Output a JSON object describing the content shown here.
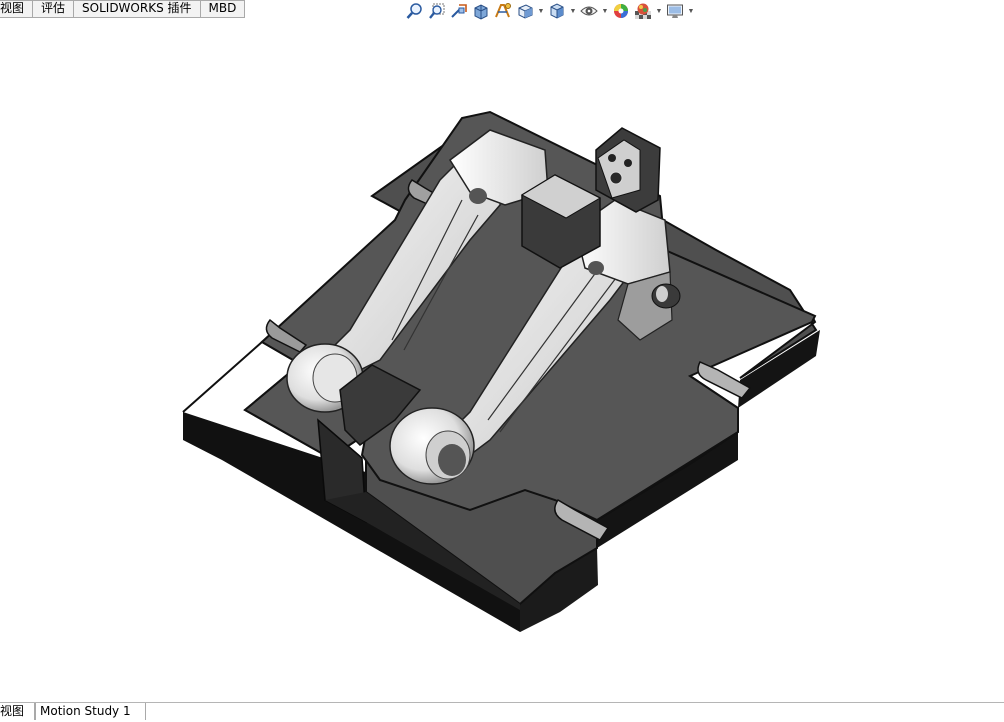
{
  "command_tabs": [
    "视图",
    "评估",
    "SOLIDWORKS 插件",
    "MBD"
  ],
  "bottom_tabs": [
    "视图",
    "Motion Study 1"
  ],
  "hud_toolbar": {
    "icons": [
      "zoom-to-fit-icon",
      "zoom-to-area-icon",
      "previous-view-icon",
      "section-view-icon",
      "dynamic-annotation-icon",
      "view-orientation-icon",
      "display-style-icon",
      "hide-show-items-icon",
      "edit-appearance-icon",
      "apply-scene-icon",
      "view-settings-icon"
    ]
  },
  "colors": {
    "base_top": "#4d4d4d",
    "base_side": "#161616",
    "part_light": "#f2f2f2",
    "part_mid": "#bdbdbd"
  }
}
